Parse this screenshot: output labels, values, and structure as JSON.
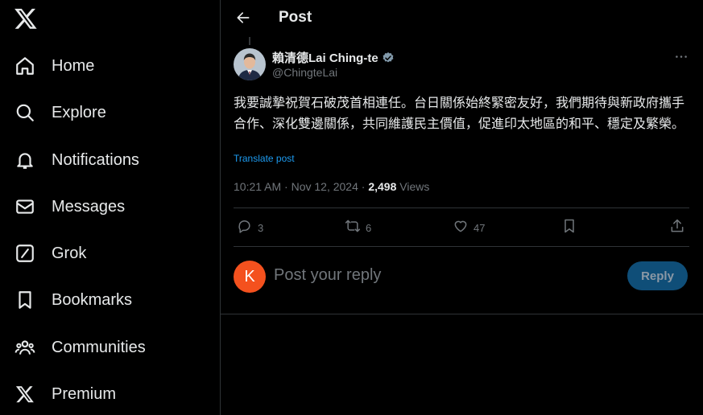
{
  "sidebar": {
    "logo_icon": "x-logo-icon",
    "items": [
      {
        "label": "Home",
        "icon": "home-icon"
      },
      {
        "label": "Explore",
        "icon": "search-icon"
      },
      {
        "label": "Notifications",
        "icon": "bell-icon"
      },
      {
        "label": "Messages",
        "icon": "envelope-icon"
      },
      {
        "label": "Grok",
        "icon": "grok-icon"
      },
      {
        "label": "Bookmarks",
        "icon": "bookmark-icon"
      },
      {
        "label": "Communities",
        "icon": "people-icon"
      },
      {
        "label": "Premium",
        "icon": "x-logo-icon"
      }
    ]
  },
  "header": {
    "title": "Post"
  },
  "post": {
    "author_name": "賴清德Lai Ching-te",
    "author_handle": "@ChingteLai",
    "text": "我要誠摯祝賀石破茂首相連任。台日關係始終緊密友好，我們期待與新政府攜手合作、深化雙邊關係，共同維護民主價值，促進印太地區的和平、穩定及繁榮。",
    "translate_label": "Translate post",
    "timestamp": "10:21 AM · Nov 12, 2024 · ",
    "views_count": "2,498",
    "views_label": " Views",
    "actions": {
      "replies": "3",
      "reposts": "6",
      "likes": "47"
    }
  },
  "reply": {
    "avatar_letter": "K",
    "placeholder": "Post your reply",
    "button_label": "Reply"
  },
  "colors": {
    "background": "#000000",
    "text": "#e7e9ea",
    "muted": "#71767b",
    "accent": "#1d9bf0",
    "reply_button": "#0f4e78",
    "reply_avatar": "#f4511e"
  }
}
